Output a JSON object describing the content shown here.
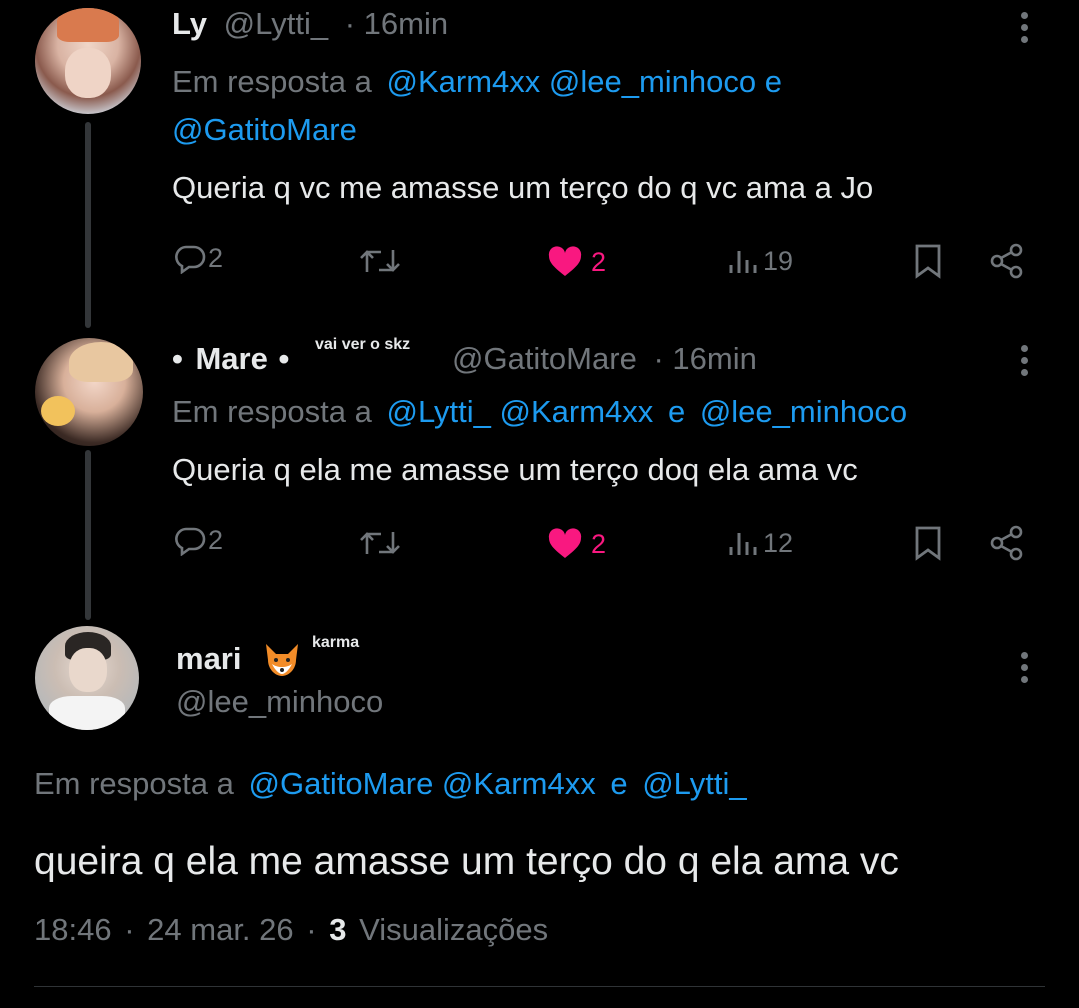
{
  "tweets": [
    {
      "name": "Ly",
      "handle": "@Lytti_",
      "sep": "·",
      "time": "16min",
      "reply_prefix": "Em resposta a",
      "reply_line1": "@Karm4xx @lee_minhoco e",
      "reply_line2": "@GatitoMare",
      "text": "Queria q vc me amasse um terço do q vc ama a Jo",
      "replies": "2",
      "likes": "2",
      "views": "19"
    },
    {
      "name_prefix": "•",
      "name": "Mare",
      "name_suffix": "•",
      "badge": "vai ver o skz",
      "handle": "@GatitoMare",
      "sep": "·",
      "time": "16min",
      "reply_prefix": "Em resposta a",
      "reply_mentions": "@Lytti_ @Karm4xx",
      "reply_and": "e",
      "reply_last": "@lee_minhoco",
      "text": "Queria q ela me amasse um terço doq ela ama vc",
      "replies": "2",
      "likes": "2",
      "views": "12"
    }
  ],
  "main_tweet": {
    "name": "mari",
    "badge": "karma",
    "handle": "@lee_minhoco",
    "reply_prefix": "Em resposta a",
    "reply_mentions": "@GatitoMare @Karm4xx",
    "reply_and": "e",
    "reply_last": "@Lytti_",
    "text": "queira q ela me amasse um terço do q ela ama vc",
    "time": "18:46",
    "sep": "·",
    "date": "24 mar. 26",
    "sep2": "·",
    "views": "3",
    "views_label": "Visualizações"
  },
  "colors": {
    "link": "#1d9bf0",
    "like": "#f91880",
    "muted": "#71767b",
    "text": "#e7e9ea"
  },
  "icons": [
    "reply-icon",
    "retweet-icon",
    "heart-icon",
    "views-icon",
    "bookmark-icon",
    "share-icon",
    "more-icon",
    "fox-emoji"
  ]
}
